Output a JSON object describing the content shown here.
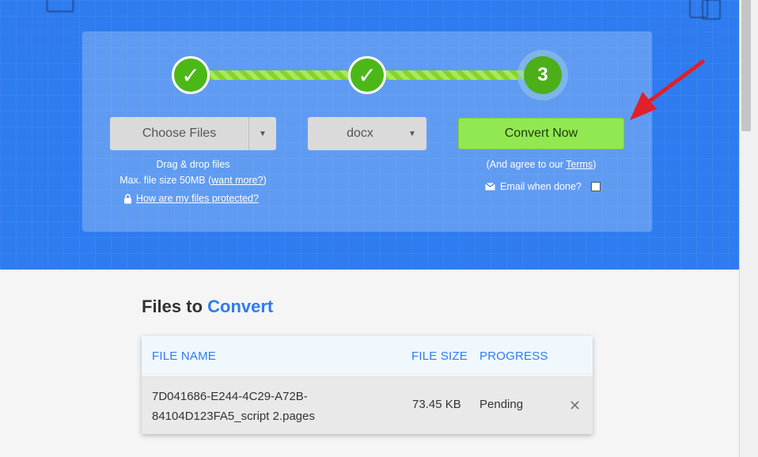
{
  "converter": {
    "steps": [
      {
        "label": "✓"
      },
      {
        "label": "✓"
      },
      {
        "label": "3"
      }
    ],
    "choose_files_label": "Choose Files",
    "format_value": "docx",
    "convert_label": "Convert Now",
    "drag_drop_text": "Drag & drop files",
    "max_size_text": "Max. file size 50MB (",
    "want_more_link": "want more?",
    "max_size_close": ")",
    "protected_link": "How are my files protected?",
    "agree_prefix": "(And agree to our ",
    "terms_link": "Terms",
    "agree_suffix": ")",
    "email_label": "Email when done?"
  },
  "files": {
    "heading_prefix": "Files to ",
    "heading_accent": "Convert",
    "columns": [
      "FILE NAME",
      "FILE SIZE",
      "PROGRESS"
    ],
    "rows": [
      {
        "name_line1": "7D041686-E244-4C29-A72B-",
        "name_line2": "84104D123FA5_script 2.pages",
        "size": "73.45 KB",
        "progress": "Pending",
        "remove": "✕"
      }
    ]
  },
  "colors": {
    "hero_blue": "#2e7cef",
    "convert_green": "#92e850",
    "step_green": "#4cb818",
    "accent_blue": "#2e7cef",
    "arrow_red": "#e0202a"
  },
  "icons": [
    "check-icon",
    "caret-down-icon",
    "lock-icon",
    "envelope-icon",
    "close-icon",
    "arrow-pointer-icon"
  ]
}
